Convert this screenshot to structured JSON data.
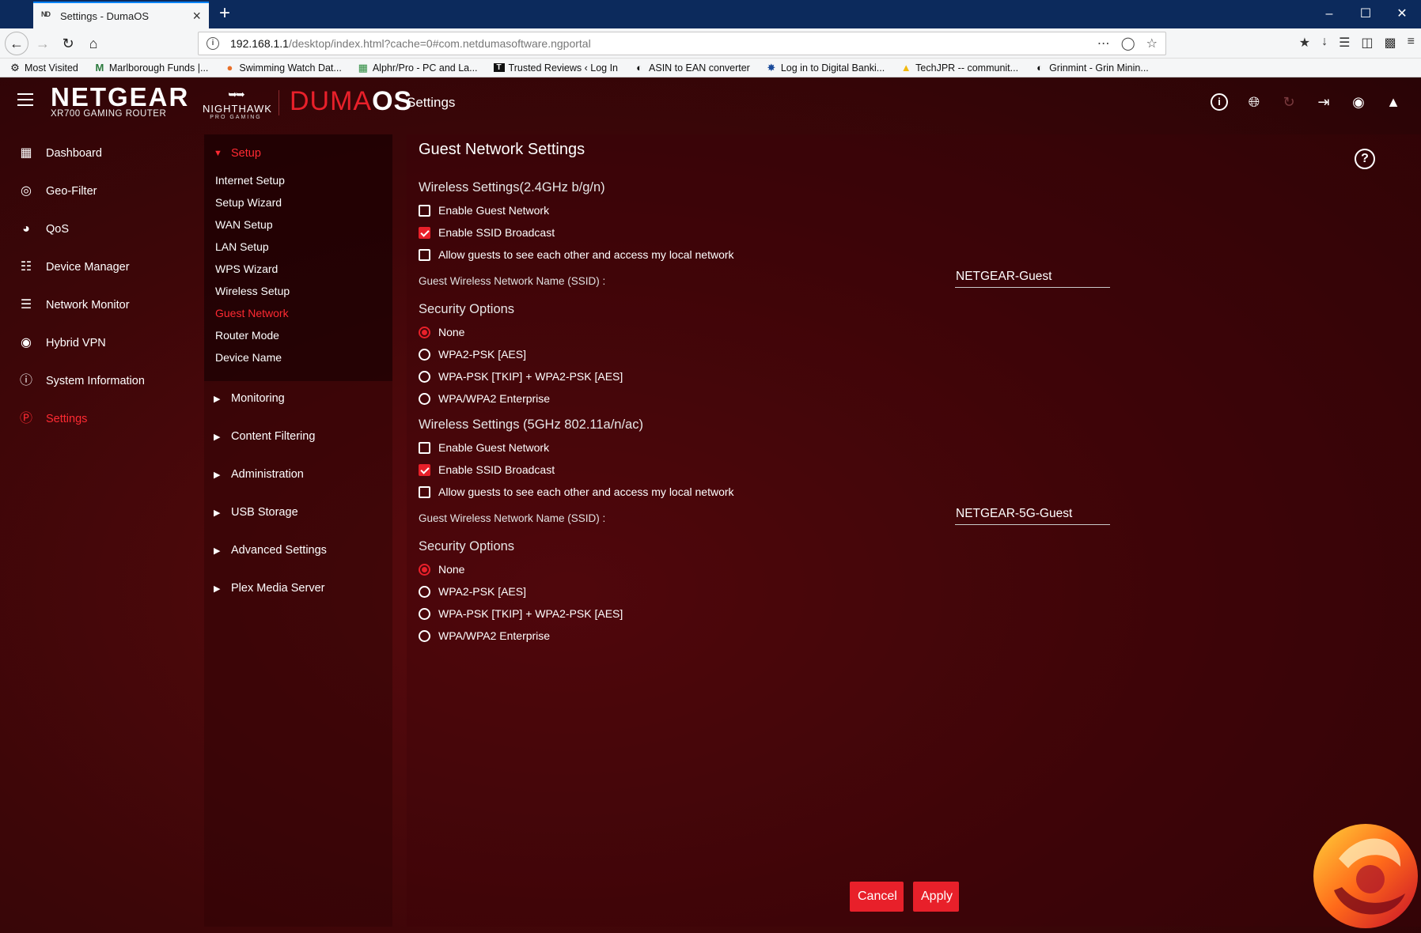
{
  "browser": {
    "tab_favicon": "ND",
    "tab_title": "Settings - DumaOS",
    "tab_close": "×",
    "new_tab": "+",
    "url_host": "192.168.1.1",
    "url_path": "/desktop/index.html?cache=0#com.netdumasoftware.ngportal",
    "bookmarks": [
      {
        "icon": "gear-icon",
        "label": "Most Visited"
      },
      {
        "icon": "m-icon",
        "label": "Marlborough Funds |..."
      },
      {
        "icon": "pin-icon",
        "label": "Swimming Watch Dat..."
      },
      {
        "icon": "sheet-icon",
        "label": "Alphr/Pro - PC and La..."
      },
      {
        "icon": "t-icon",
        "label": "Trusted Reviews ‹ Log In"
      },
      {
        "icon": "globe-icon",
        "label": "ASIN to EAN converter"
      },
      {
        "icon": "star-icon",
        "label": "Log in to Digital Banki..."
      },
      {
        "icon": "drive-icon",
        "label": "TechJPR -- communit..."
      },
      {
        "icon": "globe-icon",
        "label": "Grinmint - Grin Minin..."
      }
    ]
  },
  "header": {
    "brand": "NETGEAR",
    "brand_sub": "XR700 GAMING ROUTER",
    "nighthawk": "NIGHTHAWK",
    "nighthawk_sub": "PRO GAMING",
    "duma": "DUMA",
    "os": "OS",
    "title": "Settings"
  },
  "sidenav": {
    "items": [
      {
        "label": "Dashboard",
        "icon": "dashboard-icon"
      },
      {
        "label": "Geo-Filter",
        "icon": "geo-filter-icon"
      },
      {
        "label": "QoS",
        "icon": "qos-icon"
      },
      {
        "label": "Device Manager",
        "icon": "device-manager-icon"
      },
      {
        "label": "Network Monitor",
        "icon": "network-monitor-icon"
      },
      {
        "label": "Hybrid VPN",
        "icon": "hybrid-vpn-icon"
      },
      {
        "label": "System Information",
        "icon": "system-information-icon"
      },
      {
        "label": "Settings",
        "icon": "settings-icon",
        "active": true
      }
    ]
  },
  "submenu": {
    "setup_label": "Setup",
    "setup_items": [
      "Internet Setup",
      "Setup Wizard",
      "WAN Setup",
      "LAN Setup",
      "WPS Wizard",
      "Wireless Setup",
      "Guest Network",
      "Router Mode",
      "Device Name"
    ],
    "active_item": "Guest Network",
    "groups": [
      "Monitoring",
      "Content Filtering",
      "Administration",
      "USB Storage",
      "Advanced Settings",
      "Plex Media Server"
    ]
  },
  "main": {
    "title": "Guest Network Settings",
    "band24": {
      "heading": "Wireless Settings(2.4GHz b/g/n)",
      "enable_guest": "Enable Guest Network",
      "enable_guest_checked": false,
      "enable_ssid": "Enable SSID Broadcast",
      "enable_ssid_checked": true,
      "allow_guests": "Allow guests to see each other and access my local network",
      "allow_guests_checked": false,
      "ssid_label": "Guest Wireless Network Name (SSID) :",
      "ssid_value": "NETGEAR-Guest",
      "security_heading": "Security Options",
      "security_options": [
        "None",
        "WPA2-PSK [AES]",
        "WPA-PSK [TKIP] + WPA2-PSK [AES]",
        "WPA/WPA2 Enterprise"
      ],
      "security_selected": "None"
    },
    "band5": {
      "heading": "Wireless Settings (5GHz 802.11a/n/ac)",
      "enable_guest": "Enable Guest Network",
      "enable_guest_checked": false,
      "enable_ssid": "Enable SSID Broadcast",
      "enable_ssid_checked": true,
      "allow_guests": "Allow guests to see each other and access my local network",
      "allow_guests_checked": false,
      "ssid_label": "Guest Wireless Network Name (SSID) :",
      "ssid_value": "NETGEAR-5G-Guest",
      "security_heading": "Security Options",
      "security_options": [
        "None",
        "WPA2-PSK [AES]",
        "WPA-PSK [TKIP] + WPA2-PSK [AES]",
        "WPA/WPA2 Enterprise"
      ],
      "security_selected": "None"
    },
    "cancel_label": "Cancel",
    "apply_label": "Apply"
  },
  "colors": {
    "accent": "#e8202a",
    "background": "#3d0608",
    "browser_tabbar": "#0c2a5c"
  }
}
